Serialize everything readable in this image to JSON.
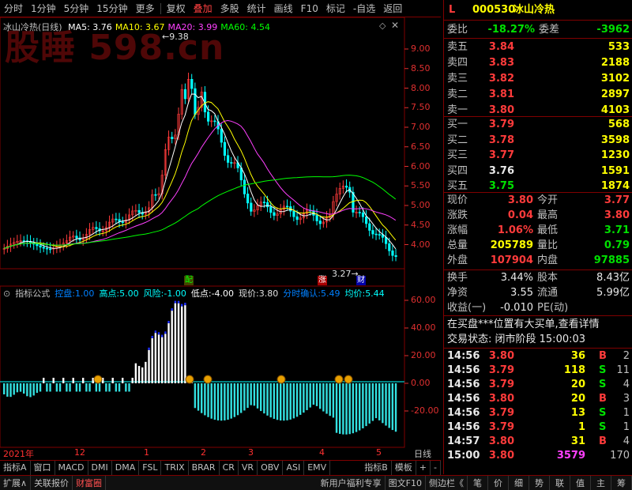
{
  "toolbar": {
    "items": [
      "分时",
      "1分钟",
      "5分钟",
      "15分钟",
      "更多",
      "复权",
      "叠加",
      "多股",
      "统计",
      "画线",
      "F10",
      "标记",
      "-自选",
      "返回"
    ]
  },
  "watermark": "股睡 598.cn",
  "chart": {
    "name": "冰山冷热(日线)",
    "ma": [
      {
        "label": "MA5: 3.76",
        "color": "#ffffff"
      },
      {
        "label": "MA10: 3.67",
        "color": "#ffff00"
      },
      {
        "label": "MA20: 3.99",
        "color": "#ff40ff"
      },
      {
        "label": "MA60: 4.54",
        "color": "#00ff00"
      }
    ],
    "high_label": "9.38",
    "low_label": "3.27",
    "y_ticks": [
      "9.00",
      "8.50",
      "8.00",
      "7.50",
      "7.00",
      "6.50",
      "6.00",
      "5.50",
      "5.00",
      "4.50",
      "4.00"
    ],
    "events": [
      {
        "text": "配",
        "color": "#00ff00",
        "bg": "#444400"
      },
      {
        "text": "涨",
        "color": "#ffffff",
        "bg": "#aa0000"
      },
      {
        "text": "财",
        "color": "#ffffff",
        "bg": "#0000aa"
      }
    ]
  },
  "indicator": {
    "name": "指标公式",
    "items": [
      {
        "label": "控盘:",
        "value": "1.00",
        "color": "#0080ff"
      },
      {
        "label": "高点:",
        "value": "5.00",
        "color": "#00ffff"
      },
      {
        "label": "风险:",
        "value": "-1.00",
        "color": "#00ffff"
      },
      {
        "label": "低点:",
        "value": "-4.00",
        "color": "#ffffff"
      },
      {
        "label": "现价:",
        "value": "3.80",
        "color": "#e0e0e0"
      },
      {
        "label": "分时确认:",
        "value": "5.49",
        "color": "#0080ff"
      },
      {
        "label": "均价:",
        "value": "5.44",
        "color": "#00ffff"
      }
    ],
    "y_ticks": [
      "60.00",
      "40.00",
      "20.00",
      "0.00",
      "-20.00"
    ]
  },
  "date_axis": {
    "labels": [
      "2021年",
      "12",
      "1",
      "2",
      "3",
      "4",
      "5"
    ],
    "right_label": "日线"
  },
  "tabs": [
    "指标A",
    "窗口",
    "MACD",
    "DMI",
    "DMA",
    "FSL",
    "TRIX",
    "BRAR",
    "CR",
    "VR",
    "OBV",
    "ASI",
    "EMV",
    "指标B",
    "模板",
    "+",
    "-"
  ],
  "status": {
    "left": [
      "扩展∧",
      "关联报价",
      "财富圈"
    ],
    "right": [
      "新用户福利专享",
      "图文F10",
      "侧边栏《",
      "笔",
      "价",
      "细",
      "势",
      "联",
      "值",
      "主",
      "筹"
    ]
  },
  "quote": {
    "header_letter": "L",
    "code": "000530",
    "name": "冰山冷热",
    "weibi_label": "委比",
    "weibi_value": "-18.27%",
    "weicha_label": "委差",
    "weicha_value": "-3962",
    "asks": [
      {
        "label": "卖五",
        "price": "3.84",
        "vol": "533"
      },
      {
        "label": "卖四",
        "price": "3.83",
        "vol": "2188"
      },
      {
        "label": "卖三",
        "price": "3.82",
        "vol": "3102"
      },
      {
        "label": "卖二",
        "price": "3.81",
        "vol": "2897"
      },
      {
        "label": "卖一",
        "price": "3.80",
        "vol": "4103"
      }
    ],
    "bids": [
      {
        "label": "买一",
        "price": "3.79",
        "vol": "568",
        "pc": "#ff3b3b"
      },
      {
        "label": "买二",
        "price": "3.78",
        "vol": "3598",
        "pc": "#ff3b3b"
      },
      {
        "label": "买三",
        "price": "3.77",
        "vol": "1230",
        "pc": "#ff3b3b"
      },
      {
        "label": "买四",
        "price": "3.76",
        "vol": "1591",
        "pc": "#e8e8e8"
      },
      {
        "label": "买五",
        "price": "3.75",
        "vol": "1874",
        "pc": "#00e000"
      }
    ],
    "stats": [
      {
        "l1": "现价",
        "v1": "3.80",
        "c1": "#ff3b3b",
        "l2": "今开",
        "v2": "3.77",
        "c2": "#ff3b3b"
      },
      {
        "l1": "涨跌",
        "v1": "0.04",
        "c1": "#ff3b3b",
        "l2": "最高",
        "v2": "3.80",
        "c2": "#ff3b3b"
      },
      {
        "l1": "涨幅",
        "v1": "1.06%",
        "c1": "#ff3b3b",
        "l2": "最低",
        "v2": "3.71",
        "c2": "#00e000"
      },
      {
        "l1": "总量",
        "v1": "205789",
        "c1": "#ffff00",
        "l2": "量比",
        "v2": "0.79",
        "c2": "#00e000"
      },
      {
        "l1": "外盘",
        "v1": "107904",
        "c1": "#ff3b3b",
        "l2": "内盘",
        "v2": "97885",
        "c2": "#00e000"
      }
    ],
    "stats2": [
      {
        "l1": "换手",
        "v1": "3.44%",
        "l2": "股本",
        "v2": "8.43亿"
      },
      {
        "l1": "净资",
        "v1": "3.55",
        "l2": "流通",
        "v2": "5.99亿"
      },
      {
        "l1": "收益(一)",
        "v1": "-0.010",
        "l2": "PE(动)",
        "v2": ""
      }
    ],
    "notice": "在买盘***位置有大买单,查看详情",
    "trade_state": "交易状态: 闭市阶段 15:00:03",
    "ticks": [
      {
        "t": "14:56",
        "p": "3.80",
        "pc": "#ff3b3b",
        "v": "36",
        "bs": "B",
        "bsc": "#ff3b3b",
        "n": "2"
      },
      {
        "t": "14:56",
        "p": "3.79",
        "pc": "#ff3b3b",
        "v": "118",
        "bs": "S",
        "bsc": "#00e000",
        "n": "11"
      },
      {
        "t": "14:56",
        "p": "3.79",
        "pc": "#ff3b3b",
        "v": "20",
        "bs": "S",
        "bsc": "#00e000",
        "n": "4"
      },
      {
        "t": "14:56",
        "p": "3.80",
        "pc": "#ff3b3b",
        "v": "20",
        "bs": "B",
        "bsc": "#ff3b3b",
        "n": "3"
      },
      {
        "t": "14:56",
        "p": "3.79",
        "pc": "#ff3b3b",
        "v": "13",
        "bs": "S",
        "bsc": "#00e000",
        "n": "1"
      },
      {
        "t": "14:56",
        "p": "3.79",
        "pc": "#ff3b3b",
        "v": "1",
        "bs": "S",
        "bsc": "#00e000",
        "n": "1"
      },
      {
        "t": "14:57",
        "p": "3.80",
        "pc": "#ff3b3b",
        "v": "31",
        "bs": "B",
        "bsc": "#ff3b3b",
        "n": "4"
      },
      {
        "t": "15:00",
        "p": "3.80",
        "pc": "#ff3b3b",
        "v": "3579",
        "vc": "#ff40ff",
        "bs": "",
        "bsc": "#ff3b3b",
        "n": "170"
      }
    ]
  }
}
